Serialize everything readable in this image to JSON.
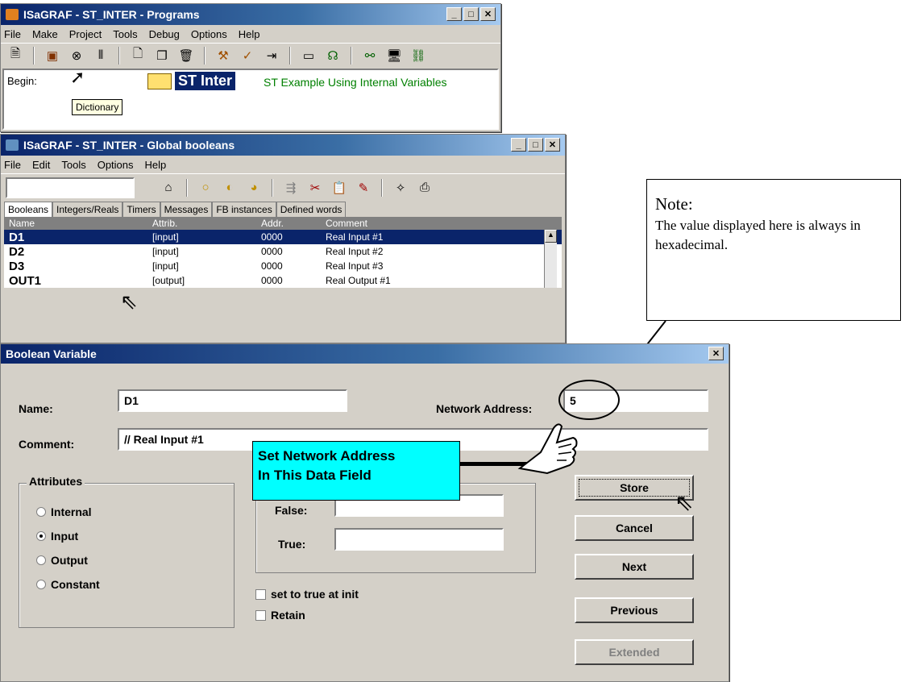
{
  "programs_window": {
    "title": "ISaGRAF - ST_INTER - Programs",
    "menu": [
      "File",
      "Make",
      "Project",
      "Tools",
      "Debug",
      "Options",
      "Help"
    ],
    "begin_label": "Begin:",
    "tooltip": "Dictionary",
    "program_name": "ST Inter",
    "program_comment": "ST Example Using Internal Variables"
  },
  "globals_window": {
    "title": "ISaGRAF - ST_INTER - Global booleans",
    "menu": [
      "File",
      "Edit",
      "Tools",
      "Options",
      "Help"
    ],
    "tabs": [
      "Booleans",
      "Integers/Reals",
      "Timers",
      "Messages",
      "FB instances",
      "Defined words"
    ],
    "columns": [
      "Name",
      "Attrib.",
      "Addr.",
      "Comment"
    ],
    "rows": [
      {
        "name": "D1",
        "attrib": "[input]",
        "addr": "0000",
        "comment": "Real Input #1"
      },
      {
        "name": "D2",
        "attrib": "[input]",
        "addr": "0000",
        "comment": "Real Input #2"
      },
      {
        "name": "D3",
        "attrib": "[input]",
        "addr": "0000",
        "comment": "Real Input #3"
      },
      {
        "name": "OUT1",
        "attrib": "[output]",
        "addr": "0000",
        "comment": "Real Output #1"
      }
    ]
  },
  "note": {
    "title": "Note:",
    "body": "The value displayed here is always in hexadecimal."
  },
  "dialog": {
    "title": "Boolean Variable",
    "name_label": "Name:",
    "name_value": "D1",
    "network_label": "Network Address:",
    "network_value": "5",
    "comment_label": "Comment:",
    "comment_value": "// Real Input #1",
    "attributes_label": "Attributes",
    "radios": [
      {
        "label": "Internal",
        "selected": false
      },
      {
        "label": "Input",
        "selected": true
      },
      {
        "label": "Output",
        "selected": false
      },
      {
        "label": "Constant",
        "selected": false
      }
    ],
    "false_label": "False:",
    "true_label": "True:",
    "check_init": "set to true at init",
    "check_retain": "Retain",
    "buttons": {
      "store": "Store",
      "cancel": "Cancel",
      "next": "Next",
      "previous": "Previous",
      "extended": "Extended"
    },
    "callout": "Set Network Address\nIn This Data Field"
  },
  "colors": {
    "title_active": "#0a246a",
    "selection": "#0a246a",
    "callout_bg": "#00ffff",
    "program_name_bg": "#0a246a",
    "comment_green": "#008000"
  }
}
